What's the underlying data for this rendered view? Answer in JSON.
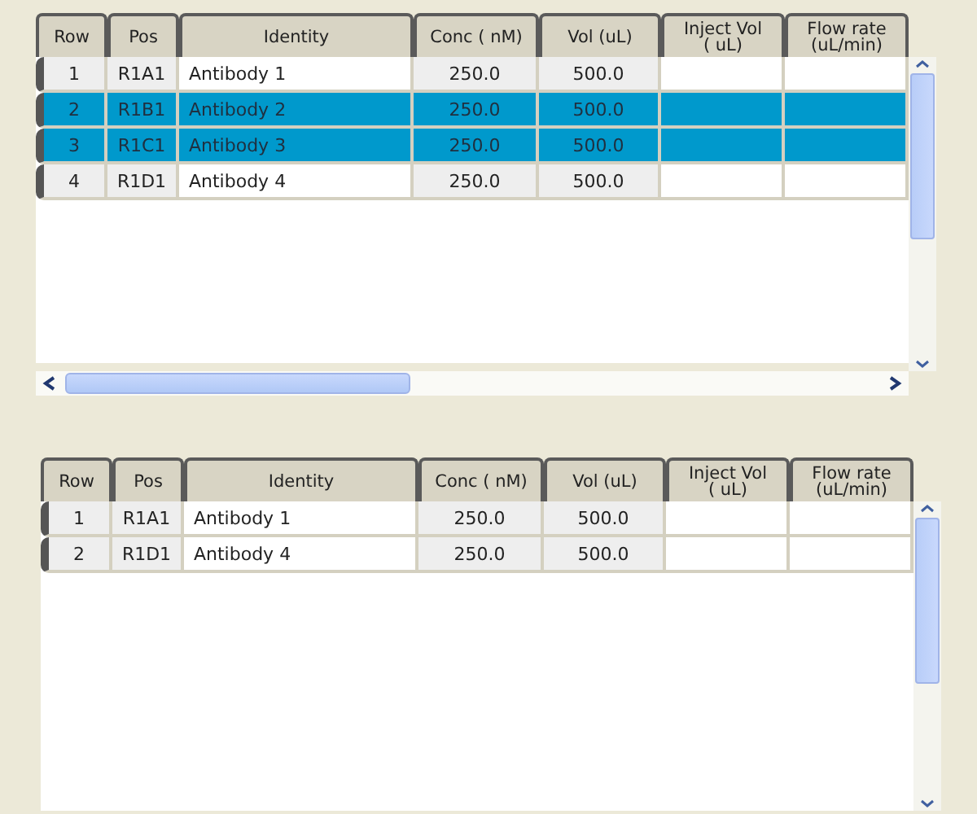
{
  "tables": [
    {
      "horizontal_scrollbar": true,
      "columns": [
        "Row",
        "Pos",
        "Identity",
        "Conc ( nM)",
        "Vol (uL)",
        "Inject Vol\n( uL)",
        "Flow rate\n(uL/min)"
      ],
      "rows": [
        {
          "selected": false,
          "cells": [
            "1",
            "R1A1",
            "Antibody 1",
            "250.0",
            "500.0",
            "",
            ""
          ]
        },
        {
          "selected": true,
          "cells": [
            "2",
            "R1B1",
            "Antibody 2",
            "250.0",
            "500.0",
            "",
            ""
          ]
        },
        {
          "selected": true,
          "cells": [
            "3",
            "R1C1",
            "Antibody 3",
            "250.0",
            "500.0",
            "",
            ""
          ]
        },
        {
          "selected": false,
          "cells": [
            "4",
            "R1D1",
            "Antibody 4",
            "250.0",
            "500.0",
            "",
            ""
          ]
        }
      ]
    },
    {
      "horizontal_scrollbar": false,
      "columns": [
        "Row",
        "Pos",
        "Identity",
        "Conc ( nM)",
        "Vol (uL)",
        "Inject Vol\n( uL)",
        "Flow rate\n(uL/min)"
      ],
      "rows": [
        {
          "selected": false,
          "cells": [
            "1",
            "R1A1",
            "Antibody 1",
            "250.0",
            "500.0",
            "",
            ""
          ]
        },
        {
          "selected": false,
          "cells": [
            "2",
            "R1D1",
            "Antibody 4",
            "250.0",
            "500.0",
            "",
            ""
          ]
        }
      ]
    }
  ]
}
